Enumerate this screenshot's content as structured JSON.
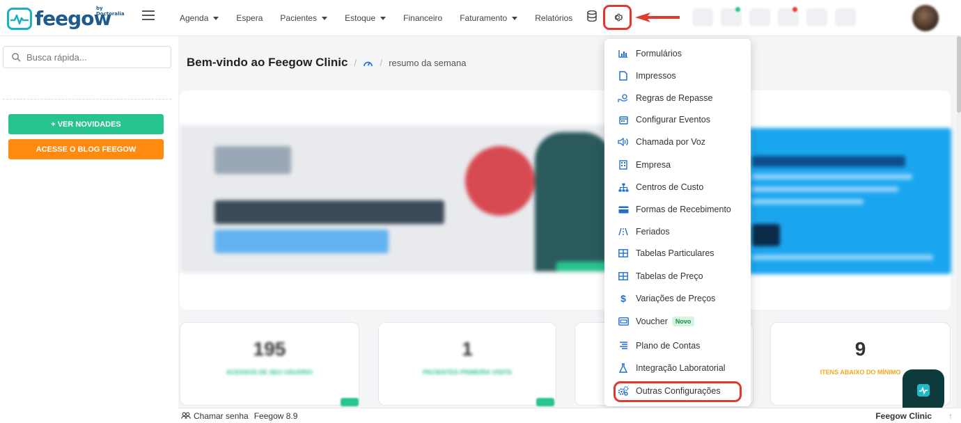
{
  "header": {
    "logo_text": "feegow",
    "logo_by": "by Doctoralia",
    "nav": [
      {
        "label": "Agenda",
        "caret": true
      },
      {
        "label": "Espera",
        "caret": false
      },
      {
        "label": "Pacientes",
        "caret": true
      },
      {
        "label": "Estoque",
        "caret": true
      },
      {
        "label": "Financeiro",
        "caret": false
      },
      {
        "label": "Faturamento",
        "caret": true
      },
      {
        "label": "Relatórios",
        "caret": false
      }
    ]
  },
  "sidebar": {
    "search_placeholder": "Busca rápida...",
    "btn_novidades": "+ VER NOVIDADES",
    "btn_blog": "ACESSE O BLOG FEEGOW"
  },
  "main": {
    "title": "Bem-vindo ao Feegow Clinic",
    "crumb": "resumo da semana",
    "stats": [
      {
        "value": "195",
        "label": "ACESSOS DE SEU USUÁRIO",
        "color": "#28c48e",
        "blurred": true
      },
      {
        "value": "1",
        "label": "PACIENTES PRIMEIRA VISITA",
        "color": "#28c48e",
        "blurred": true
      },
      {
        "value": "",
        "label": "",
        "color": "#28c48e",
        "blurred": true
      },
      {
        "value": "9",
        "label": "ITENS ABAIXO DO MÍNIMO",
        "color": "#f0a81e",
        "blurred": false
      }
    ]
  },
  "dropdown": {
    "items": [
      {
        "label": "Formulários",
        "icon": "chart-icon"
      },
      {
        "label": "Impressos",
        "icon": "document-icon"
      },
      {
        "label": "Regras de Repasse",
        "icon": "hand-coin-icon"
      },
      {
        "label": "Configurar Eventos",
        "icon": "calendar-icon"
      },
      {
        "label": "Chamada por Voz",
        "icon": "speaker-icon"
      },
      {
        "label": "Empresa",
        "icon": "building-icon"
      },
      {
        "label": "Centros de Custo",
        "icon": "hierarchy-icon"
      },
      {
        "label": "Formas de Recebimento",
        "icon": "card-icon"
      },
      {
        "label": "Feriados",
        "icon": "road-icon"
      },
      {
        "label": "Tabelas Particulares",
        "icon": "table-icon"
      },
      {
        "label": "Tabelas de Preço",
        "icon": "table-icon"
      },
      {
        "label": "Variações de Preços",
        "icon": "dollar-icon"
      },
      {
        "label": "Voucher",
        "icon": "voucher-icon",
        "badge": "Novo"
      },
      {
        "label": "Plano de Contas",
        "icon": "list-icon"
      },
      {
        "label": "Integração Laboratorial",
        "icon": "flask-icon"
      },
      {
        "label": "Outras Configurações",
        "icon": "gears-icon"
      }
    ]
  },
  "footer": {
    "chamar": "Chamar senha",
    "version": "Feegow 8.9",
    "clinic": "Feegow Clinic"
  },
  "colors": {
    "accent_red": "#e03a2e",
    "brand_blue": "#1d5b8f",
    "green": "#28c48e",
    "orange": "#ff8a10",
    "icon_blue": "#1e6fd0"
  }
}
